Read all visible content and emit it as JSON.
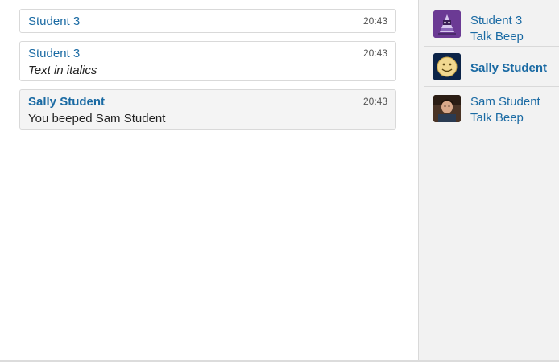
{
  "messages": [
    {
      "author": "Student 3",
      "time": "20:43",
      "text": ""
    },
    {
      "author": "Student 3",
      "time": "20:43",
      "text": "Text in italics"
    },
    {
      "author": "Sally Student",
      "time": "20:43",
      "text": "You beeped Sam Student"
    }
  ],
  "users": [
    {
      "name": "Student 3",
      "action": "Talk Beep",
      "avatar_icon": "robot-avatar-icon"
    },
    {
      "name": "Sally Student",
      "action": "",
      "avatar_icon": "smiley-moon-avatar-icon"
    },
    {
      "name": "Sam Student",
      "action": "Talk Beep",
      "avatar_icon": "person-photo-avatar"
    }
  ],
  "colors": {
    "link": "#1a6aa3",
    "self_message_bg": "#f4f4f4",
    "user_pane_bg": "#f2f2f2"
  }
}
